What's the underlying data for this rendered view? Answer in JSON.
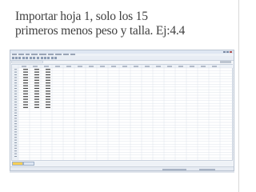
{
  "slide": {
    "title_line1": "Importar hoja 1, solo los 15",
    "title_line2": "primeros  menos peso y talla. Ej:4.4"
  },
  "app": {
    "columns": [
      "",
      "Peso",
      "Talla",
      "Pretest",
      "var",
      "var",
      "var",
      "var",
      "var",
      "var",
      "var",
      "var",
      "var",
      "var",
      "var",
      "var",
      "var",
      "var",
      "var"
    ],
    "rows_with_data": 15,
    "total_rows_visible": 34,
    "tabs": [
      "Vista de datos",
      "Vista de variables"
    ],
    "active_tab": "Vista de datos",
    "colors": {
      "grid": "#d7dde6",
      "header": "#eef2f7",
      "active_tab": "#f6cf57",
      "cell_text": "#404040"
    }
  }
}
